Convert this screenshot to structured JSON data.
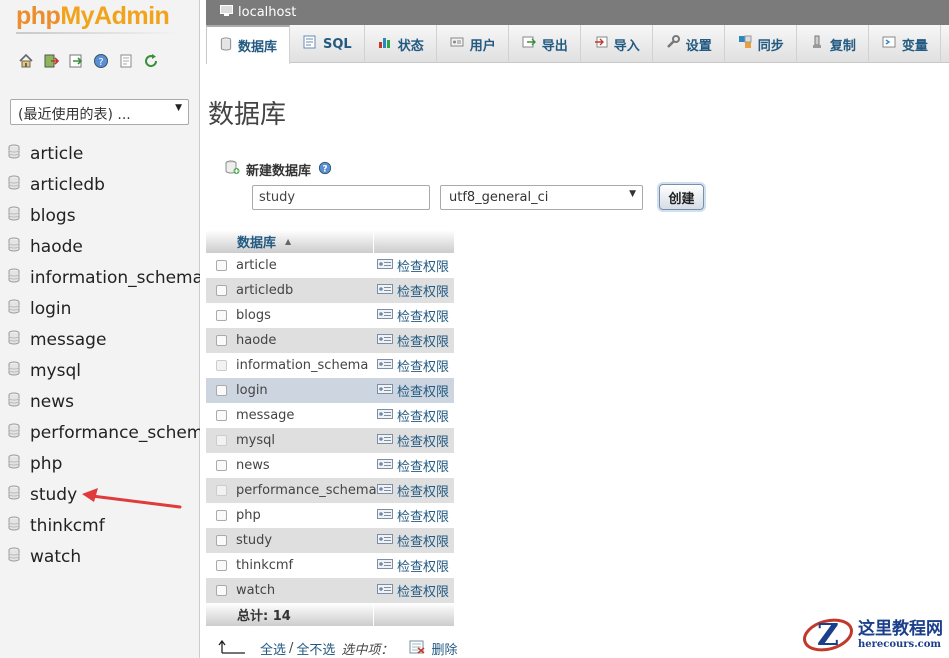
{
  "logo": {
    "php": "php",
    "myadmin": "MyAdmin"
  },
  "quick_icons": [
    "home-icon",
    "exit-icon",
    "sql-window-icon",
    "help-icon",
    "docs-icon",
    "reload-icon"
  ],
  "recent_tables": {
    "selected": "(最近使用的表) ..."
  },
  "nav_databases": [
    "article",
    "articledb",
    "blogs",
    "haode",
    "information_schema",
    "login",
    "message",
    "mysql",
    "news",
    "performance_schema",
    "php",
    "study",
    "thinkcmf",
    "watch"
  ],
  "server": {
    "label": "localhost"
  },
  "tabs": [
    {
      "label": "数据库",
      "icon": "database-icon",
      "active": true
    },
    {
      "label": "SQL",
      "icon": "sql-icon"
    },
    {
      "label": "状态",
      "icon": "status-icon"
    },
    {
      "label": "用户",
      "icon": "users-icon"
    },
    {
      "label": "导出",
      "icon": "export-icon"
    },
    {
      "label": "导入",
      "icon": "import-icon"
    },
    {
      "label": "设置",
      "icon": "settings-icon"
    },
    {
      "label": "同步",
      "icon": "sync-icon"
    },
    {
      "label": "复制",
      "icon": "replication-icon"
    },
    {
      "label": "变量",
      "icon": "variables-icon"
    },
    {
      "label": "",
      "icon": "more-icon"
    }
  ],
  "page_title": "数据库",
  "create_db": {
    "label": "新建数据库",
    "name_value": "study",
    "collation": "utf8_general_ci",
    "button": "创建"
  },
  "table": {
    "header_name": "数据库",
    "priv_label": "检查权限",
    "rows": [
      {
        "name": "article"
      },
      {
        "name": "articledb"
      },
      {
        "name": "blogs"
      },
      {
        "name": "haode"
      },
      {
        "name": "information_schema",
        "system": true
      },
      {
        "name": "login",
        "hover": true
      },
      {
        "name": "message"
      },
      {
        "name": "mysql",
        "system": true
      },
      {
        "name": "news"
      },
      {
        "name": "performance_schema",
        "system": true
      },
      {
        "name": "php"
      },
      {
        "name": "study"
      },
      {
        "name": "thinkcmf"
      },
      {
        "name": "watch"
      }
    ],
    "total": "总计: 14"
  },
  "footer": {
    "select_all": "全选",
    "separator": "/",
    "deselect_all": "全不选",
    "with_selected": "选中项：",
    "delete": "删除"
  },
  "watermark": {
    "line1": "这里教程网",
    "line2": "herecours.com"
  },
  "colors": {
    "link": "#235a81",
    "topbar": "#7b7b7b",
    "logo_orange": "#ec8e2d",
    "arrow_red": "#e03a3a"
  }
}
